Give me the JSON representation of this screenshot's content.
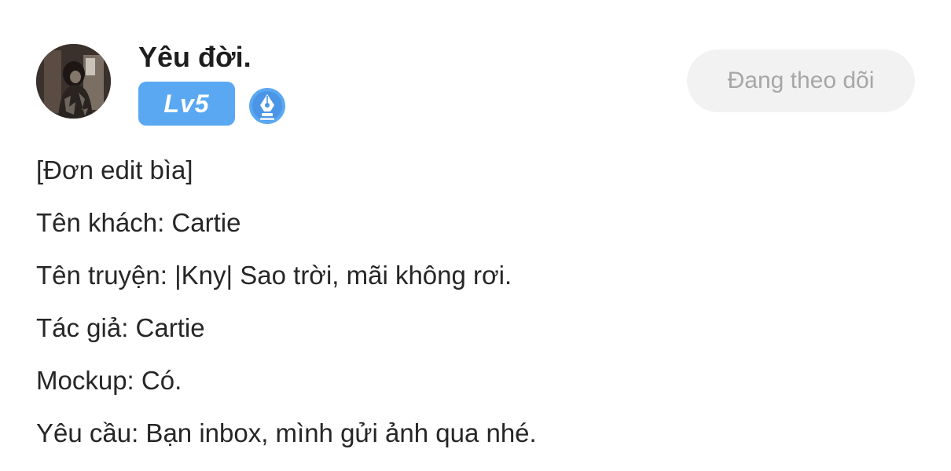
{
  "user": {
    "name": "Yêu đời.",
    "level": "Lv5",
    "avatar_icon": "avatar-photo",
    "badge_icon": "pen-nib-icon",
    "badge_color": "#5aa8f2"
  },
  "follow_button": {
    "label": "Đang theo dõi",
    "bg_color": "#f2f2f2",
    "text_color": "#a7a7a7"
  },
  "content": {
    "lines": [
      "[Đơn edit bìa]",
      "Tên khách: Cartie",
      "Tên truyện: |Kny| Sao trời, mãi không rơi.",
      "Tác giả: Cartie",
      "Mockup: Có.",
      "Yêu cầu: Bạn inbox, mình gửi ảnh qua nhé."
    ]
  }
}
